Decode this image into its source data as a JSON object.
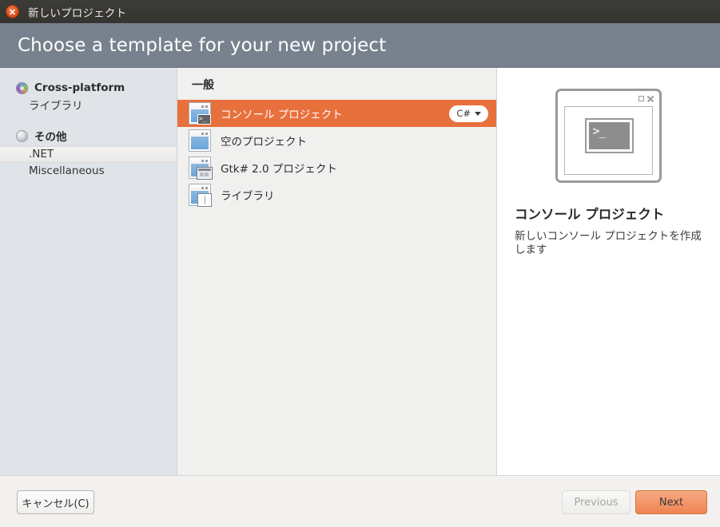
{
  "window": {
    "title": "新しいプロジェクト",
    "close_icon": "close-icon"
  },
  "banner": {
    "heading": "Choose a template for your new project"
  },
  "sidebar": {
    "groups": [
      {
        "label": "Cross-platform",
        "icon": "platform-ring-icon",
        "items": [
          {
            "label": "ライブラリ",
            "selected": false
          }
        ]
      },
      {
        "label": "その他",
        "icon": "other-ring-icon",
        "items": [
          {
            "label": ".NET",
            "selected": true
          },
          {
            "label": "Miscellaneous",
            "selected": false
          }
        ]
      }
    ]
  },
  "template_list": {
    "group_label": "一般",
    "items": [
      {
        "label": "コンソール プロジェクト",
        "icon": "console-project-icon",
        "selected": true,
        "language_badge": "C#"
      },
      {
        "label": "空のプロジェクト",
        "icon": "empty-project-icon",
        "selected": false
      },
      {
        "label": "Gtk# 2.0 プロジェクト",
        "icon": "gtk-project-icon",
        "selected": false
      },
      {
        "label": "ライブラリ",
        "icon": "library-project-icon",
        "selected": false
      }
    ]
  },
  "preview": {
    "art_icon": "console-window-illustration",
    "prompt_glyph": ">_",
    "title": "コンソール プロジェクト",
    "description": "新しいコンソール プロジェクトを作成します"
  },
  "footer": {
    "cancel_label": "キャンセル(C)",
    "previous_label": "Previous",
    "next_label": "Next"
  },
  "colors": {
    "accent_orange": "#e8703c",
    "banner_slate": "#78828e",
    "titlebar_dark": "#3c3b37",
    "next_button": "#ee8452",
    "sidebar_bg": "#e0e3e8"
  }
}
